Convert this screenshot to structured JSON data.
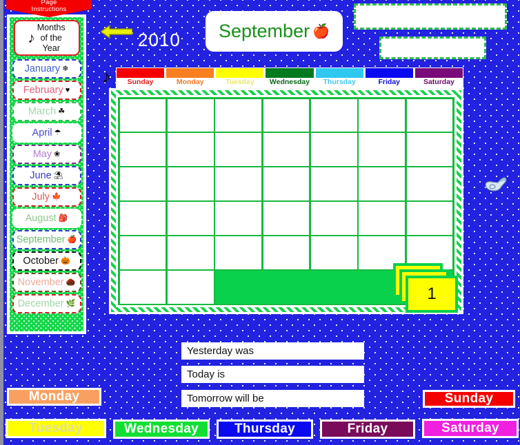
{
  "page": {
    "banner_line1": "Page",
    "banner_line2": "Instructions",
    "background_color": "#2222e0"
  },
  "sidebar": {
    "heading": "Months of the Year",
    "heading_line1": "Months",
    "heading_line2": "of the",
    "heading_line3": "Year",
    "heading_icon": "music-note-icon",
    "heading_icon_glyph": "♪",
    "months": [
      {
        "label": "January",
        "text_color": "#3d5fd0",
        "border_color": "#2b3fc0",
        "icon": "snowflake-icon",
        "glyph": "❄"
      },
      {
        "label": "February",
        "text_color": "#e0607a",
        "border_color": "#d02020",
        "icon": "heart-icon",
        "glyph": "♥"
      },
      {
        "label": "March",
        "text_color": "#9fd8a8",
        "border_color": "#2fbd4a",
        "icon": "clover-icon",
        "glyph": "☘"
      },
      {
        "label": "April",
        "text_color": "#4b4bd0",
        "border_color": "#ffffff",
        "icon": "umbrella-icon",
        "glyph": "☂"
      },
      {
        "label": "May",
        "text_color": "#b57fd0",
        "border_color": "#7a2f8a",
        "icon": "flower-icon",
        "glyph": "❀"
      },
      {
        "label": "June",
        "text_color": "#3a3ac0",
        "border_color": "#2b3fc0",
        "icon": "sandcastle-icon",
        "glyph": "⛱"
      },
      {
        "label": "July",
        "text_color": "#e05a5a",
        "border_color": "#d02020",
        "icon": "maple-leaf-icon",
        "glyph": "🍁"
      },
      {
        "label": "August",
        "text_color": "#8fc88f",
        "border_color": "#ffffff",
        "icon": "backpack-icon",
        "glyph": "🎒"
      },
      {
        "label": "September",
        "text_color": "#6fbf6f",
        "border_color": "#2b3fc0",
        "icon": "apple-icon",
        "glyph": "🍎"
      },
      {
        "label": "October",
        "text_color": "#111111",
        "border_color": "#111111",
        "icon": "pumpkin-icon",
        "glyph": "🎃"
      },
      {
        "label": "November",
        "text_color": "#f0a898",
        "border_color": "#6b4a20",
        "icon": "acorn-icon",
        "glyph": "🌰"
      },
      {
        "label": "December",
        "text_color": "#9fd8a8",
        "border_color": "#d02020",
        "icon": "holly-icon",
        "glyph": "🌿"
      }
    ]
  },
  "header": {
    "back_arrow": "back-arrow-icon",
    "year": "2010",
    "month_title": "September",
    "month_icon": "apple-icon",
    "month_icon_glyph": "🍎",
    "month_title_color": "#179017",
    "note_icon": "music-note-icon",
    "note_icon_glyph": "♪"
  },
  "top_right_boxes": [
    {
      "name": "top-right-box-1",
      "value": ""
    },
    {
      "name": "top-right-box-2",
      "value": ""
    }
  ],
  "calendar": {
    "day_headers": [
      {
        "label": "Sunday",
        "bar_color": "#f50000",
        "text_color": "#e02020"
      },
      {
        "label": "Monday",
        "bar_color": "#f98020",
        "text_color": "#f07828"
      },
      {
        "label": "Tuesday",
        "bar_color": "#ffff00",
        "text_color": "#e8e870"
      },
      {
        "label": "Wednesday",
        "bar_color": "#007a1e",
        "text_color": "#0a6a18"
      },
      {
        "label": "Thursday",
        "bar_color": "#2ec8f0",
        "text_color": "#44c8ee"
      },
      {
        "label": "Friday",
        "bar_color": "#0a0af0",
        "text_color": "#1010d8"
      },
      {
        "label": "Saturday",
        "bar_color": "#7a0a7a",
        "text_color": "#6a0a6a"
      }
    ],
    "rows": 6,
    "columns": 7,
    "cells": [
      [
        "",
        "",
        "",
        "",
        "",
        "",
        ""
      ],
      [
        "",
        "",
        "",
        "",
        "",
        "",
        ""
      ],
      [
        "",
        "",
        "",
        "",
        "",
        "",
        ""
      ],
      [
        "",
        "",
        "",
        "",
        "",
        "",
        ""
      ],
      [
        "",
        "",
        "",
        "",
        "",
        "",
        ""
      ],
      [
        "",
        "",
        "GREENBAND"
      ]
    ],
    "date_card_value": "1",
    "date_card_color": "#ffff00",
    "grid_color": "#16b83f"
  },
  "pointer": {
    "icon": "pointing-hand-icon"
  },
  "sentences": [
    {
      "name": "yesterday-was",
      "label": "Yesterday was"
    },
    {
      "name": "today-is",
      "label": "Today is"
    },
    {
      "name": "tomorrow-will-be",
      "label": "Tomorrow will be"
    }
  ],
  "day_buttons": [
    {
      "name": "monday-button",
      "label": "Monday",
      "bg": "#f9a060",
      "text_color": "#ffffff"
    },
    {
      "name": "sunday-button",
      "label": "Sunday",
      "bg": "#f50000",
      "text_color": "#ffffff"
    },
    {
      "name": "tuesday-button",
      "label": "Tuesday",
      "bg": "#ffff00",
      "text_color": "#e0e0a0"
    },
    {
      "name": "wednesday-button",
      "label": "Wednesday",
      "bg": "#11e033",
      "text_color": "#ffffff"
    },
    {
      "name": "thursday-button",
      "label": "Thursday",
      "bg": "#0a0af0",
      "text_color": "#ffffff"
    },
    {
      "name": "friday-button",
      "label": "Friday",
      "bg": "#7a0a5a",
      "text_color": "#ffffff"
    },
    {
      "name": "saturday-button",
      "label": "Saturday",
      "bg": "#f020e0",
      "text_color": "#ffffff"
    }
  ]
}
